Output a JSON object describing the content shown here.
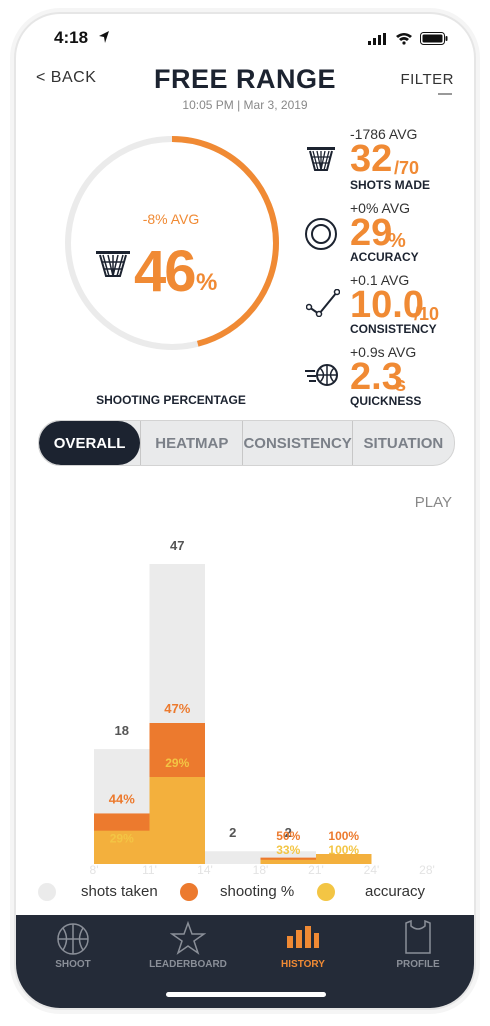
{
  "status": {
    "time": "4:18"
  },
  "header": {
    "back": "< BACK",
    "title": "FREE RANGE",
    "subtitle": "10:05 PM | Mar 3, 2019",
    "filter": "FILTER"
  },
  "summary": {
    "avg": "-8% AVG",
    "value": "46",
    "unit": "%",
    "label": "SHOOTING PERCENTAGE",
    "progress_fraction": 0.46,
    "accent": "#f08a34"
  },
  "stats": [
    {
      "icon": "basket-icon",
      "avg": "-1786 AVG",
      "value": "32",
      "suffix": "/70",
      "label": "SHOTS MADE"
    },
    {
      "icon": "target-icon",
      "avg": "+0% AVG",
      "value": "29",
      "suffix": "%",
      "label": "ACCURACY"
    },
    {
      "icon": "trend-icon",
      "avg": "+0.1 AVG",
      "value": "10.0",
      "suffix": "/10",
      "label": "CONSISTENCY"
    },
    {
      "icon": "fast-ball-icon",
      "avg": "+0.9s AVG",
      "value": "2.3",
      "suffix": "s",
      "label": "QUICKNESS"
    }
  ],
  "tabs": [
    "OVERALL",
    "HEATMAP",
    "CONSISTENCY",
    "SITUATION"
  ],
  "play": "PLAY",
  "chart_data": {
    "type": "bar",
    "categories": [
      "8'-11'",
      "11'-14'",
      "14'-18'",
      "18'-21'",
      "21'-24'",
      "24'-28'"
    ],
    "x_ticks": [
      "8'",
      "11'",
      "14'",
      "18'",
      "21'",
      "24'",
      "28'"
    ],
    "series": [
      {
        "name": "shots taken",
        "values": [
          18,
          47,
          2,
          2,
          0,
          0
        ],
        "labels": [
          "18",
          "47",
          "2",
          "2",
          "",
          ""
        ]
      },
      {
        "name": "shooting %",
        "values": [
          44,
          47,
          0,
          50,
          100,
          0
        ],
        "labels": [
          "44%",
          "47%",
          "",
          "50%",
          "100%",
          ""
        ]
      },
      {
        "name": "accuracy",
        "values": [
          29,
          29,
          0,
          33,
          100,
          0
        ],
        "labels": [
          "29%",
          "29%",
          "",
          "33%",
          "100%",
          ""
        ]
      }
    ],
    "colors": {
      "shots taken": "#ebebeb",
      "shooting %": "#ec7a2e",
      "accuracy": "#f3b03d"
    }
  },
  "legend": [
    {
      "label": "shots taken",
      "color": "#ebebeb"
    },
    {
      "label": "shooting %",
      "color": "#ec7a2e"
    },
    {
      "label": "accuracy",
      "color": "#f3c544"
    }
  ],
  "nav": [
    {
      "icon": "basketball-icon",
      "label": "SHOOT"
    },
    {
      "icon": "star-icon",
      "label": "LEADERBOARD"
    },
    {
      "icon": "bar-chart-icon",
      "label": "HISTORY",
      "active": true
    },
    {
      "icon": "jersey-icon",
      "label": "PROFILE"
    }
  ]
}
